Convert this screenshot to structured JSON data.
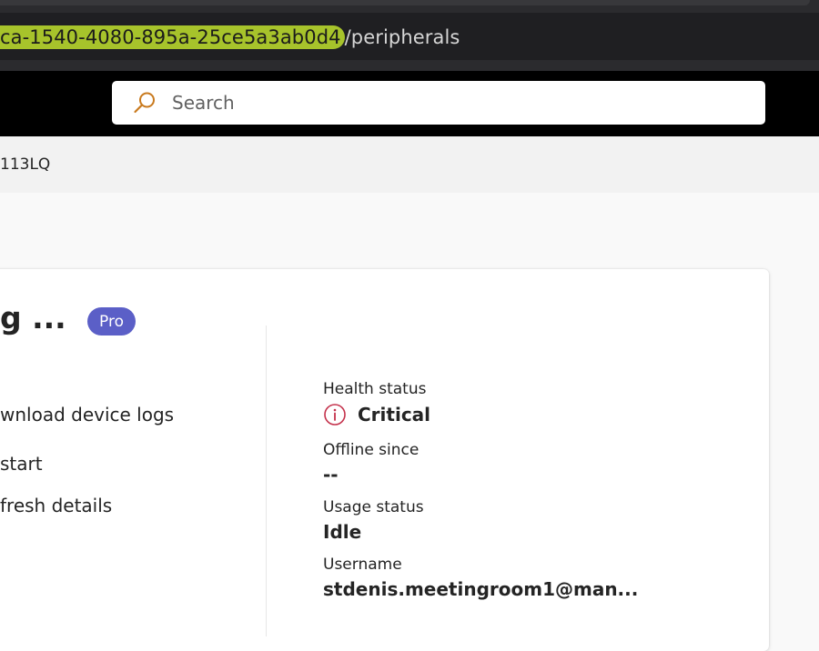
{
  "browser": {
    "url_highlighted": "ca-1540-4080-895a-25ce5a3ab0d4",
    "url_rest": "/peripherals",
    "highlight_color": "#a7c32b"
  },
  "header": {
    "search_placeholder": "Search",
    "search_icon": "search-icon"
  },
  "breadcrumb": {
    "text": "113LQ"
  },
  "card": {
    "title": "g ...",
    "badge": "Pro",
    "badge_color": "#5b5fc7",
    "actions": [
      {
        "label": "wnload device logs"
      },
      {
        "label": "start"
      },
      {
        "label": "fresh details"
      }
    ],
    "properties": {
      "health_label": "Health status",
      "health_value": "Critical",
      "health_icon": "info-circle-icon",
      "health_color": "#c4314b",
      "offline_label": "Offline since",
      "offline_value": "--",
      "usage_label": "Usage status",
      "usage_value": "Idle",
      "username_label": "Username",
      "username_value": "stdenis.meetingroom1@man..."
    }
  }
}
